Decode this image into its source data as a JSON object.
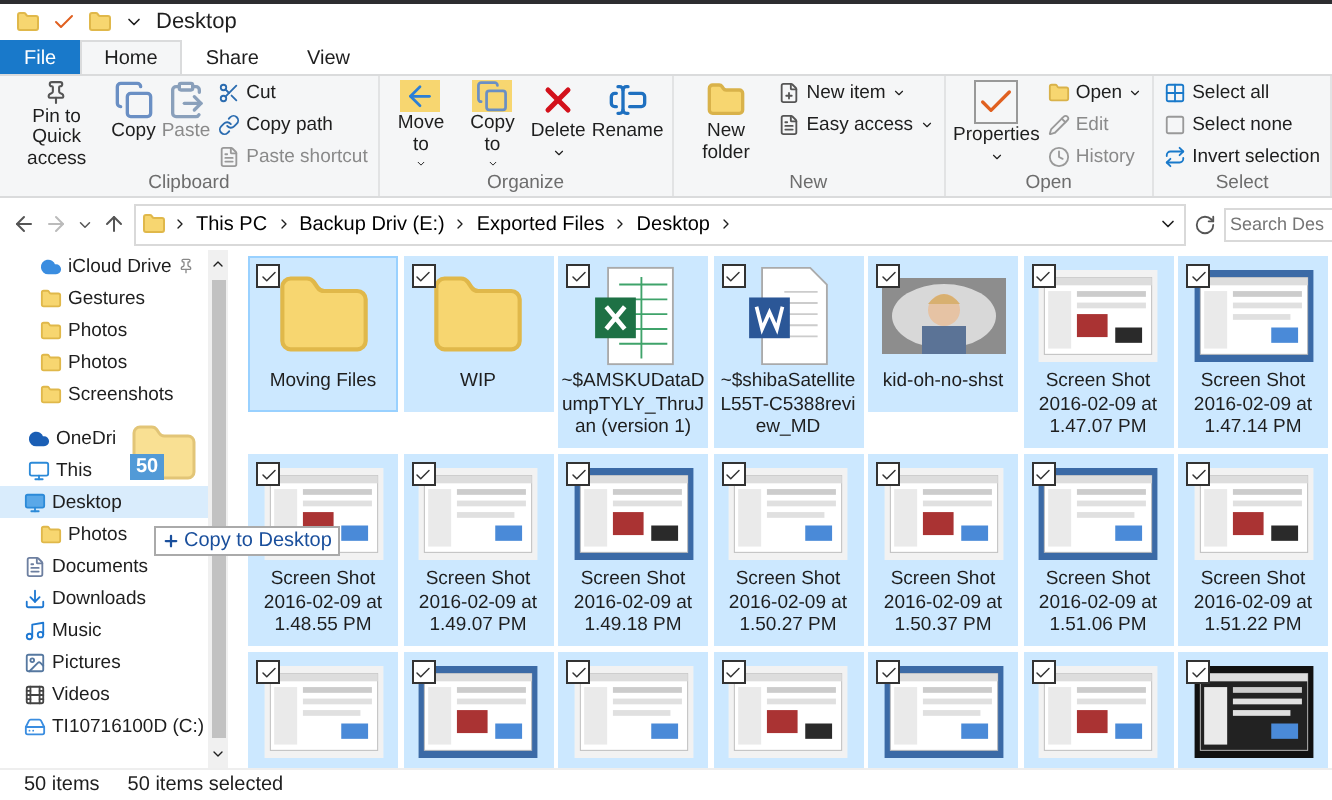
{
  "title_bar": {
    "title": "Desktop"
  },
  "ribbon_tabs": [
    {
      "label": "File",
      "kind": "file",
      "selected": false
    },
    {
      "label": "Home",
      "kind": "tab",
      "selected": true
    },
    {
      "label": "Share",
      "kind": "tab",
      "selected": false
    },
    {
      "label": "View",
      "kind": "tab",
      "selected": false
    }
  ],
  "ribbon_groups": [
    {
      "name": "Clipboard",
      "large": [
        {
          "label": "Pin to Quick access",
          "menu": false,
          "disabled": false
        },
        {
          "label": "Copy",
          "menu": false,
          "disabled": false
        },
        {
          "label": "Paste",
          "menu": false,
          "disabled": true
        }
      ],
      "small": [
        {
          "label": "Cut",
          "menu": false,
          "disabled": false
        },
        {
          "label": "Copy path",
          "menu": false,
          "disabled": false
        },
        {
          "label": "Paste shortcut",
          "menu": false,
          "disabled": true
        }
      ]
    },
    {
      "name": "Organize",
      "large": [
        {
          "label": "Move to",
          "menu": true,
          "disabled": false
        },
        {
          "label": "Copy to",
          "menu": true,
          "disabled": false
        },
        {
          "label": "Delete",
          "menu": true,
          "disabled": false
        },
        {
          "label": "Rename",
          "menu": false,
          "disabled": false
        }
      ]
    },
    {
      "name": "New",
      "large": [
        {
          "label": "New folder",
          "menu": false,
          "disabled": false
        }
      ],
      "small": [
        {
          "label": "New item",
          "menu": true,
          "disabled": false
        },
        {
          "label": "Easy access",
          "menu": true,
          "disabled": false
        }
      ]
    },
    {
      "name": "Open",
      "large": [
        {
          "label": "Properties",
          "menu": true,
          "disabled": false
        }
      ],
      "small": [
        {
          "label": "Open",
          "menu": true,
          "disabled": false
        },
        {
          "label": "Edit",
          "menu": false,
          "disabled": true
        },
        {
          "label": "History",
          "menu": false,
          "disabled": true
        }
      ]
    },
    {
      "name": "Select",
      "small": [
        {
          "label": "Select all",
          "menu": false,
          "disabled": false
        },
        {
          "label": "Select none",
          "menu": false,
          "disabled": false
        },
        {
          "label": "Invert selection",
          "menu": false,
          "disabled": false
        }
      ]
    }
  ],
  "address_bar": {
    "path": [
      "This PC",
      "Backup Driv (E:)",
      "Exported Files",
      "Desktop"
    ],
    "search_placeholder": "Search Des"
  },
  "nav_pane": [
    {
      "label": "iCloud Drive",
      "kind": "cloud",
      "pinned": true,
      "selected": false
    },
    {
      "label": "Gestures",
      "kind": "folder",
      "pinned": false,
      "selected": false
    },
    {
      "label": "Photos",
      "kind": "folder",
      "pinned": false,
      "selected": false
    },
    {
      "label": "Photos",
      "kind": "folder",
      "pinned": false,
      "selected": false
    },
    {
      "label": "Screenshots",
      "kind": "folder",
      "pinned": false,
      "selected": false
    },
    {
      "label": "OneDri",
      "kind": "onedrive",
      "pinned": false,
      "selected": false
    },
    {
      "label": "This",
      "kind": "pc",
      "pinned": false,
      "selected": false,
      "children": [
        {
          "label": "Desktop",
          "kind": "desktop",
          "pinned": false,
          "selected": true,
          "children": [
            {
              "label": "Photos",
              "kind": "folder",
              "pinned": false,
              "selected": false
            }
          ]
        },
        {
          "label": "Documents",
          "kind": "documents",
          "pinned": false,
          "selected": false
        },
        {
          "label": "Downloads",
          "kind": "downloads",
          "pinned": false,
          "selected": false
        },
        {
          "label": "Music",
          "kind": "music",
          "pinned": false,
          "selected": false
        },
        {
          "label": "Pictures",
          "kind": "pictures",
          "pinned": false,
          "selected": false
        },
        {
          "label": "Videos",
          "kind": "videos",
          "pinned": false,
          "selected": false
        },
        {
          "label": "TI10716100D (C:)",
          "kind": "drive",
          "pinned": false,
          "selected": false
        }
      ]
    }
  ],
  "drag": {
    "count": "50",
    "tooltip": "Copy to Desktop"
  },
  "files": [
    {
      "kind": "folder",
      "label": "Moving Files",
      "checked": true,
      "selected": true,
      "focused": true
    },
    {
      "kind": "folder",
      "label": "WIP",
      "checked": true,
      "selected": true,
      "focused": false
    },
    {
      "kind": "excel",
      "label": "~$AMSKUDataDumpTYLY_ThruJan (version 1)",
      "checked": true,
      "selected": true,
      "focused": false
    },
    {
      "kind": "word",
      "label": "~$shibaSatelliteL55T-C5388review_MD",
      "checked": true,
      "selected": true,
      "focused": false
    },
    {
      "label": "kid-oh-no-shst",
      "checked": true,
      "selected": true,
      "focused": false
    },
    {
      "kind": "screenshot",
      "label": "Screen Shot 2016-02-09 at 1.47.07 PM",
      "checked": true,
      "selected": true,
      "focused": false
    },
    {
      "kind": "screenshot",
      "label": "Screen Shot 2016-02-09 at 1.47.14 PM",
      "checked": true,
      "selected": true,
      "focused": false
    },
    {
      "kind": "screenshot",
      "label": "Screen Shot 2016-02-09 at 1.48.55 PM",
      "checked": true,
      "selected": true,
      "focused": false
    },
    {
      "kind": "screenshot",
      "label": "Screen Shot 2016-02-09 at 1.49.07 PM",
      "checked": true,
      "selected": true,
      "focused": false
    },
    {
      "kind": "screenshot",
      "label": "Screen Shot 2016-02-09 at 1.49.18 PM",
      "checked": true,
      "selected": true,
      "focused": false
    },
    {
      "kind": "screenshot",
      "label": "Screen Shot 2016-02-09 at 1.50.27 PM",
      "checked": true,
      "selected": true,
      "focused": false
    },
    {
      "kind": "screenshot",
      "label": "Screen Shot 2016-02-09 at 1.50.37 PM",
      "checked": true,
      "selected": true,
      "focused": false
    },
    {
      "kind": "screenshot",
      "label": "Screen Shot 2016-02-09 at 1.51.06 PM",
      "checked": true,
      "selected": true,
      "focused": false
    },
    {
      "kind": "screenshot",
      "label": "Screen Shot 2016-02-09 at 1.51.22 PM",
      "checked": true,
      "selected": true,
      "focused": false
    },
    {
      "kind": "screenshot",
      "checked": true,
      "selected": true,
      "focused": false
    },
    {
      "kind": "screenshot",
      "checked": true,
      "selected": true,
      "focused": false
    },
    {
      "kind": "screenshot",
      "checked": true,
      "selected": true,
      "focused": false
    },
    {
      "kind": "screenshot",
      "checked": true,
      "selected": true,
      "focused": false
    },
    {
      "kind": "screenshot",
      "checked": true,
      "selected": true,
      "focused": false
    },
    {
      "kind": "screenshot",
      "checked": true,
      "selected": true,
      "focused": false
    },
    {
      "kind": "screenshot",
      "checked": true,
      "selected": true,
      "focused": false
    }
  ],
  "status_bar": [
    "50 items",
    "50 items selected"
  ]
}
